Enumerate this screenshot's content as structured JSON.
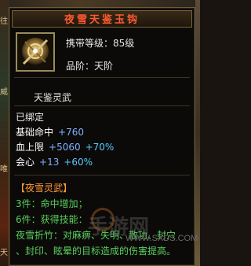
{
  "tooltip": {
    "title": "夜雪天鉴玉钩",
    "carry_level": "携带等级：85级",
    "grade": "品阶：天阶",
    "item_name": "天鉴灵武",
    "bound": "已绑定",
    "stats": [
      {
        "label": "基础命中",
        "value": "+760",
        "percent": ""
      },
      {
        "label": "血上限",
        "value": "+5060",
        "percent": "+70%"
      },
      {
        "label": "会心",
        "value": "+13",
        "percent": "+60%"
      }
    ],
    "set": {
      "title": "【夜雪灵武】",
      "piece3": "3件：命中增加；",
      "piece6": "6件：获得技能：",
      "desc1": "夜雪折竹：对麻痹、失明、散功、封穴",
      "desc2": "、封印、眩晕的目标造成的伤害提高。"
    }
  },
  "watermark": {
    "url": "WWW.SXDS.COM",
    "brand": "手游网"
  },
  "background": {
    "left_fragments": [
      "往",
      "威",
      "唯",
      "天"
    ]
  },
  "colors": {
    "title": "#ff5a30",
    "stat_value": "#7fb0ff",
    "stat_percent": "#58c8ff",
    "set_text": "#58d060",
    "set_title": "#ff9a3a"
  }
}
